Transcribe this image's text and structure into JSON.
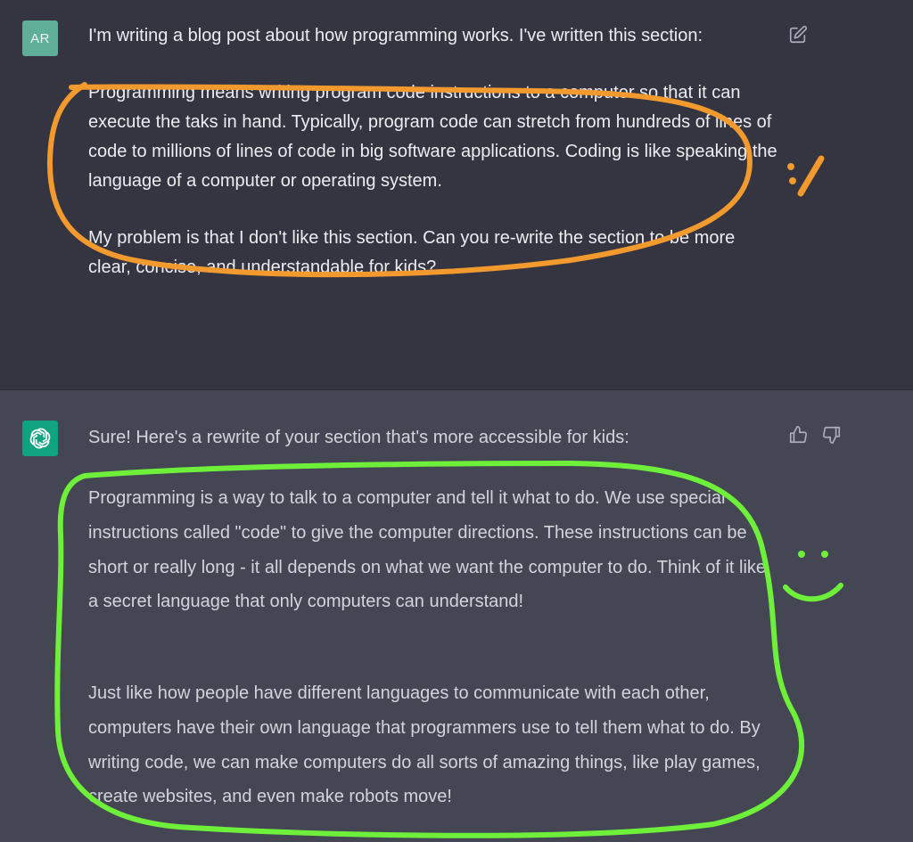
{
  "user_message": {
    "avatar": "AR",
    "intro": "I'm writing a blog post about how programming works. I've written this section:",
    "quoted_section": "Programming means writing program code instructions to a computer so that it can execute the taks in hand. Typically, program code can stretch from hundreds of lines of code to millions of lines of code in big software applications. Coding is like speaking the language of a computer or operating system.",
    "question": "My problem is that I don't like this section. Can you re-write the section to be more clear, concise, and understandable for kids?"
  },
  "assistant_message": {
    "intro": "Sure! Here's a rewrite of your section that's more accessible for kids:",
    "paragraph_1": "Programming is a way to talk to a computer and tell it what to do. We use special instructions called \"code\" to give the computer directions. These instructions can be short or really long - it all depends on what we want the computer to do. Think of it like a secret language that only computers can understand!",
    "paragraph_2": "Just like how people have different languages to communicate with each other, computers have their own language that programmers use to tell them what to do. By writing code, we can make computers do all sorts of amazing things, like play games, create websites, and even make robots move!"
  },
  "icons": {
    "edit": "edit-icon",
    "thumbs_up": "thumbs-up-icon",
    "thumbs_down": "thumbs-down-icon",
    "assistant_avatar": "openai-logo-icon"
  },
  "colors": {
    "user_bg": "#343541",
    "assistant_bg": "#444654",
    "annotation_orange": "#f39a2e",
    "annotation_green": "#6ef03a"
  }
}
